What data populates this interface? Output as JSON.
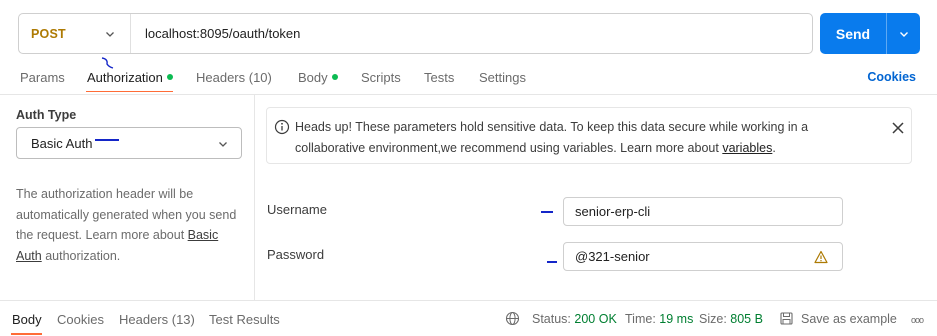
{
  "request": {
    "method": "POST",
    "url": "localhost:8095/oauth/token",
    "send_label": "Send"
  },
  "tabs": [
    {
      "label": "Params"
    },
    {
      "label": "Authorization"
    },
    {
      "label": "Headers (10)"
    },
    {
      "label": "Body"
    },
    {
      "label": "Scripts"
    },
    {
      "label": "Tests"
    },
    {
      "label": "Settings"
    }
  ],
  "cookies_label": "Cookies",
  "auth": {
    "type_label": "Auth Type",
    "selected": "Basic Auth",
    "desc_text": "The authorization header will be automatically generated when you send the request. Learn more about ",
    "desc_link": "Basic Auth",
    "desc_tail": " authorization."
  },
  "banner": {
    "text": "Heads up! These parameters hold sensitive data. To keep this data secure while working in a collaborative environment,we recommend using variables. Learn more about ",
    "link": "variables",
    "tail": "."
  },
  "fields": {
    "username_label": "Username",
    "username_value": "senior-erp-cli",
    "password_label": "Password",
    "password_value": "@321-senior"
  },
  "response": {
    "tabs": [
      {
        "label": "Body"
      },
      {
        "label": "Cookies"
      },
      {
        "label": "Headers (13)"
      },
      {
        "label": "Test Results"
      }
    ],
    "status_label": "Status:",
    "status_value": "200 OK",
    "time_label": "Time:",
    "time_value": "19 ms",
    "size_label": "Size:",
    "size_value": "805 B",
    "save_label": "Save as example",
    "more": "ooo"
  },
  "colors": {
    "accent": "#097bed",
    "method": "#ad7a03",
    "active_tab_underline": "#ff6c37",
    "status_dot": "#0cbb52",
    "status_ok": "#007f31",
    "link": "#0265d2"
  }
}
